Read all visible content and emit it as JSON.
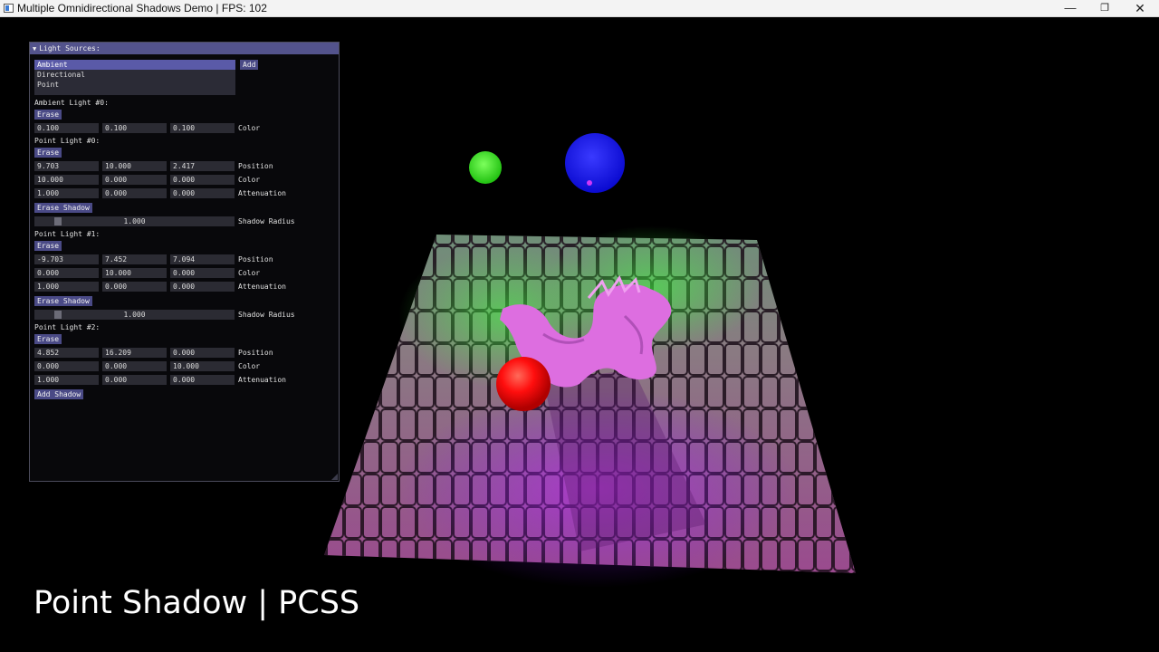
{
  "window": {
    "title": "Multiple Omnidirectional Shadows Demo | FPS: 102"
  },
  "panel": {
    "header": "Light Sources:",
    "list": [
      "Ambient",
      "Directional",
      "Point"
    ],
    "selected": "Ambient",
    "add_label": "Add"
  },
  "ambient": {
    "heading": "Ambient Light #0:",
    "erase": "Erase",
    "color": [
      "0.100",
      "0.100",
      "0.100"
    ],
    "color_label": "Color"
  },
  "point0": {
    "heading": "Point Light #0:",
    "erase": "Erase",
    "position": [
      "9.703",
      "10.000",
      "2.417"
    ],
    "color": [
      "10.000",
      "0.000",
      "0.000"
    ],
    "attenuation": [
      "1.000",
      "0.000",
      "0.000"
    ],
    "erase_shadow": "Erase Shadow",
    "shadow_radius": "1.000"
  },
  "point1": {
    "heading": "Point Light #1:",
    "erase": "Erase",
    "position": [
      "-9.703",
      "7.452",
      "7.094"
    ],
    "color": [
      "0.000",
      "10.000",
      "0.000"
    ],
    "attenuation": [
      "1.000",
      "0.000",
      "0.000"
    ],
    "erase_shadow": "Erase Shadow",
    "shadow_radius": "1.000"
  },
  "point2": {
    "heading": "Point Light #2:",
    "erase": "Erase",
    "position": [
      "4.852",
      "16.209",
      "0.000"
    ],
    "color": [
      "0.000",
      "0.000",
      "10.000"
    ],
    "attenuation": [
      "1.000",
      "0.000",
      "0.000"
    ],
    "add_shadow": "Add Shadow"
  },
  "labels": {
    "position": "Position",
    "color": "Color",
    "attenuation": "Attenuation",
    "shadow_radius": "Shadow Radius"
  },
  "caption": "Point Shadow | PCSS",
  "scene_colors": {
    "green_light": "#33ee22",
    "blue_light": "#1414f0",
    "red_light": "#ff0a0a",
    "floor_tint": "#a0508c",
    "dragon": "#e070e0"
  }
}
